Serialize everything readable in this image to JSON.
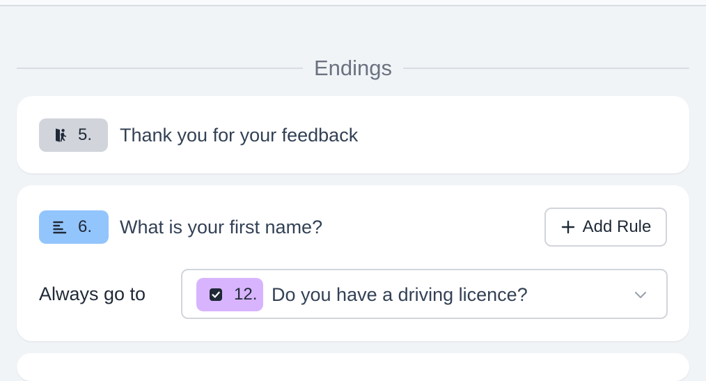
{
  "section": {
    "title": "Endings"
  },
  "endings": [
    {
      "number": "5.",
      "icon": "exit-icon",
      "title": "Thank you for your feedback",
      "badge_color": "#d1d5db"
    }
  ],
  "questions": [
    {
      "number": "6.",
      "icon": "short-text-icon",
      "title": "What is your first name?",
      "badge_color": "#93c5fd",
      "add_rule_label": "Add Rule",
      "always_go_to_label": "Always go to",
      "target": {
        "number": "12.",
        "icon": "checkbox-icon",
        "title": "Do you have a driving licence?",
        "badge_color": "#d8b4fe"
      }
    }
  ]
}
